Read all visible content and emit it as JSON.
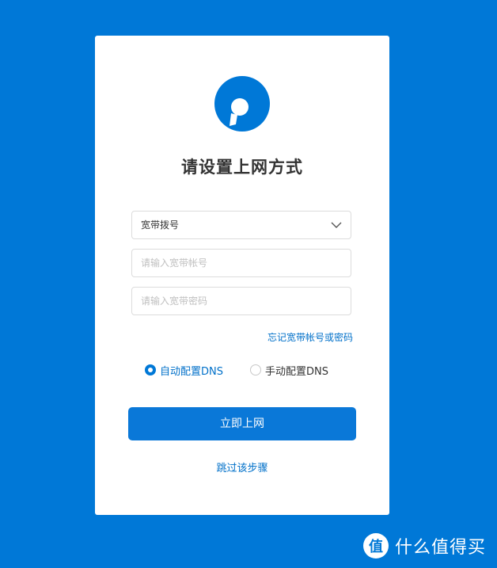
{
  "page": {
    "title": "请设置上网方式"
  },
  "form": {
    "mode_select": "宽带拨号",
    "account_placeholder": "请输入宽带帐号",
    "password_placeholder": "请输入宽带密码",
    "forgot_link": "忘记宽带帐号或密码",
    "dns_options": [
      {
        "label": "自动配置DNS",
        "selected": true
      },
      {
        "label": "手动配置DNS",
        "selected": false
      }
    ],
    "submit_label": "立即上网",
    "skip_label": "跳过该步骤"
  },
  "watermark": {
    "logo_char": "值",
    "text": "什么值得买"
  },
  "colors": {
    "background": "#0078d7",
    "accent": "#0a78d8",
    "link": "#0070c9"
  }
}
